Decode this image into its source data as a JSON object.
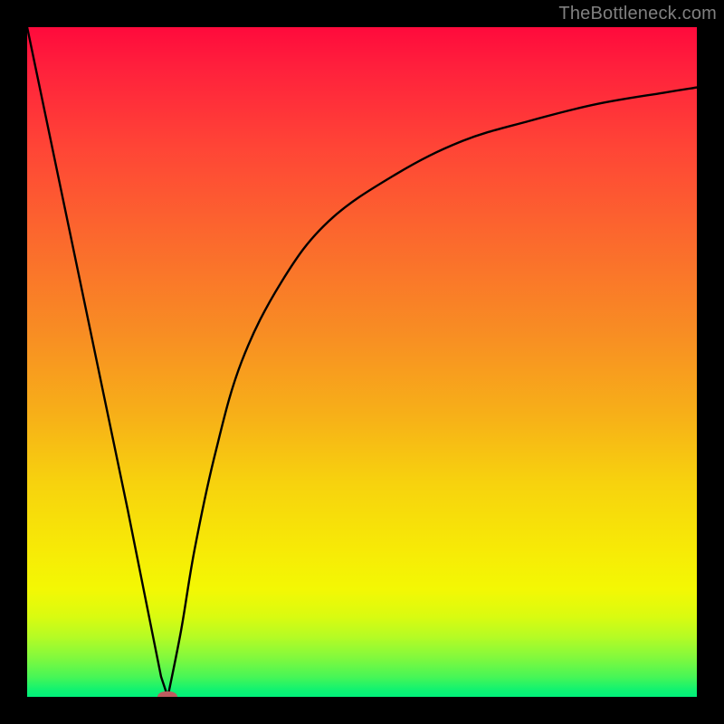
{
  "watermark": "TheBottleneck.com",
  "colors": {
    "background": "#000000",
    "marker": "#bd5c60",
    "curve": "#000000",
    "gradient_top": "#ff0a3c",
    "gradient_bottom": "#00ef7a"
  },
  "chart_data": {
    "type": "line",
    "title": "",
    "xlabel": "",
    "ylabel": "",
    "xlim": [
      0,
      100
    ],
    "ylim": [
      0,
      100
    ],
    "grid": false,
    "legend": false,
    "background": "red-yellow-green vertical gradient (red=high bottleneck, green=balanced)",
    "series": [
      {
        "name": "bottleneck-curve-left",
        "x": [
          0,
          5,
          10,
          15,
          18,
          20,
          21
        ],
        "values": [
          100,
          76,
          52,
          28,
          13,
          3,
          0
        ]
      },
      {
        "name": "bottleneck-curve-right",
        "x": [
          21,
          23,
          25,
          28,
          32,
          38,
          45,
          55,
          65,
          75,
          85,
          95,
          100
        ],
        "values": [
          0,
          10,
          22,
          36,
          50,
          62,
          71,
          78,
          83,
          86,
          88.5,
          90.2,
          91
        ]
      }
    ],
    "marker": {
      "x": 21,
      "y": 0,
      "label": ""
    }
  }
}
